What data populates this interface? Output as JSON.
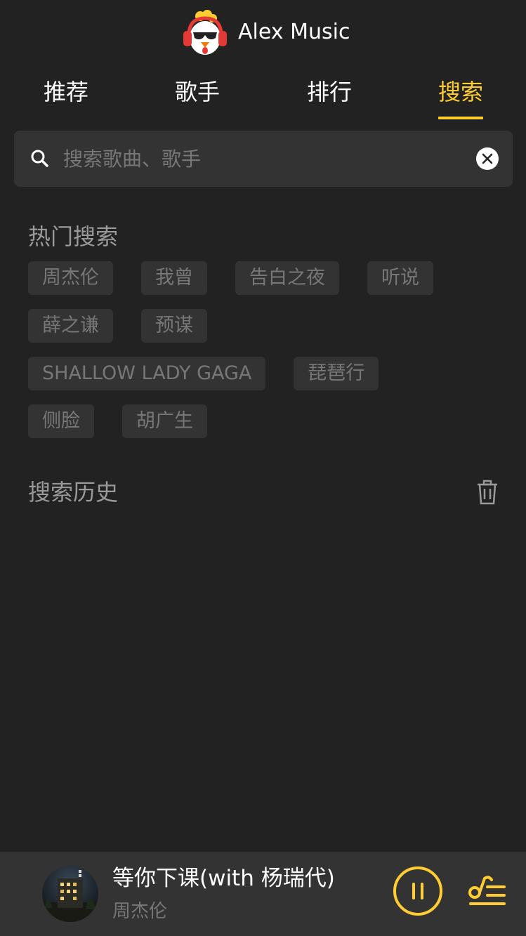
{
  "app": {
    "title": "Alex Music",
    "accent_color": "#ffcd32",
    "background_color": "#222222"
  },
  "tabs": [
    {
      "label": "推荐",
      "active": false
    },
    {
      "label": "歌手",
      "active": false
    },
    {
      "label": "排行",
      "active": false
    },
    {
      "label": "搜索",
      "active": true
    }
  ],
  "search": {
    "value": "",
    "placeholder": "搜索歌曲、歌手",
    "icon": "search-icon",
    "clear_icon": "close-circle-icon"
  },
  "hot_search": {
    "title": "热门搜索",
    "rows": [
      [
        "周杰伦",
        "我曾",
        "告白之夜",
        "听说"
      ],
      [
        "薛之谦",
        "预谋"
      ],
      [
        "SHALLOW LADY GAGA",
        "琵琶行"
      ],
      [
        "侧脸",
        "胡广生"
      ]
    ]
  },
  "history": {
    "title": "搜索历史",
    "clear_icon": "trash-icon",
    "items": []
  },
  "player": {
    "song_title": "等你下课(with 杨瑞代)",
    "artist": "周杰伦",
    "state_icon": "pause-circle-icon",
    "playlist_icon": "playlist-icon"
  }
}
